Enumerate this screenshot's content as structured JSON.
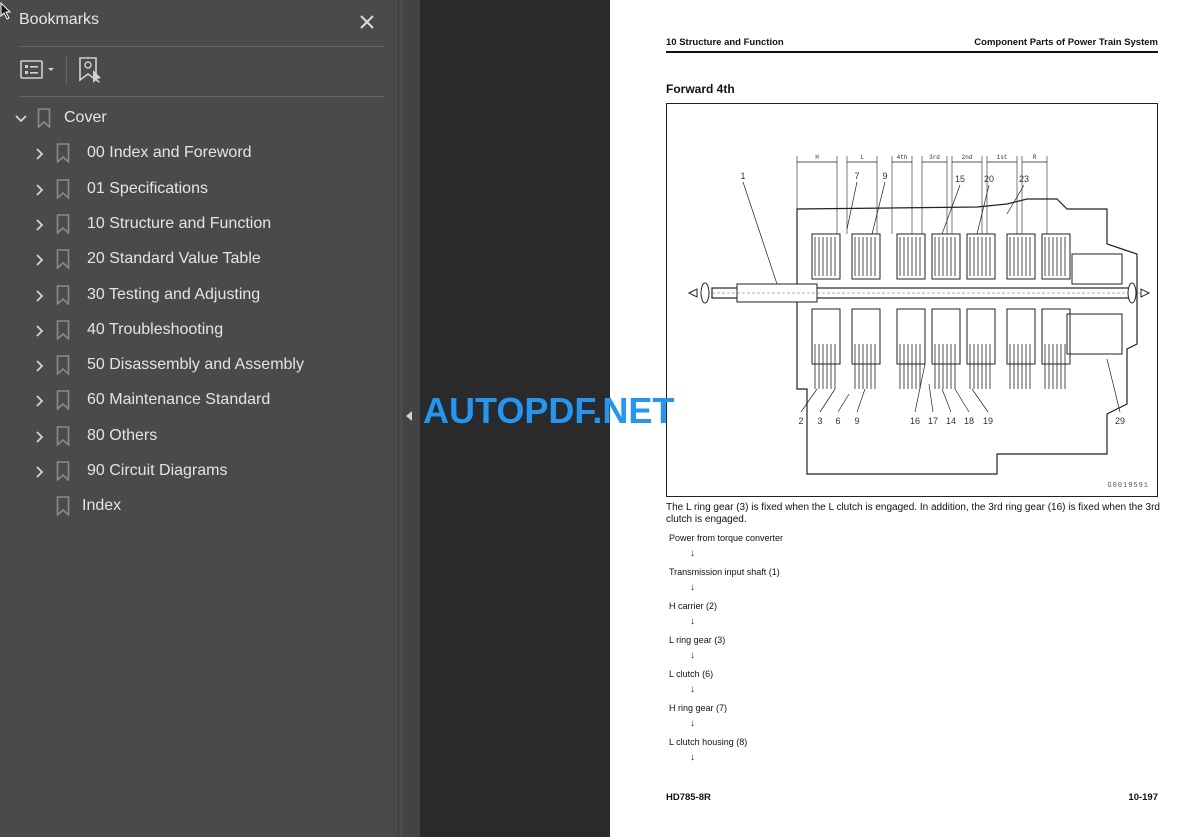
{
  "sidebar": {
    "title": "Bookmarks",
    "close_label": "✕",
    "toolbar": {
      "options_icon": "list-options-icon",
      "find_bookmark_icon": "find-current-bookmark-icon"
    },
    "items": [
      {
        "label": "Cover",
        "level": 0,
        "expanded": true,
        "has_children": true
      },
      {
        "label": "00 Index and Foreword",
        "level": 1,
        "expanded": false,
        "has_children": true
      },
      {
        "label": "01 Specifications",
        "level": 1,
        "expanded": false,
        "has_children": true
      },
      {
        "label": "10 Structure and Function",
        "level": 1,
        "expanded": false,
        "has_children": true
      },
      {
        "label": "20 Standard Value Table",
        "level": 1,
        "expanded": false,
        "has_children": true
      },
      {
        "label": "30 Testing and Adjusting",
        "level": 1,
        "expanded": false,
        "has_children": true
      },
      {
        "label": "40 Troubleshooting",
        "level": 1,
        "expanded": false,
        "has_children": true
      },
      {
        "label": "50 Disassembly and Assembly",
        "level": 1,
        "expanded": false,
        "has_children": true
      },
      {
        "label": "60 Maintenance Standard",
        "level": 1,
        "expanded": false,
        "has_children": true
      },
      {
        "label": "80 Others",
        "level": 1,
        "expanded": false,
        "has_children": true
      },
      {
        "label": "90 Circuit Diagrams",
        "level": 1,
        "expanded": false,
        "has_children": true
      },
      {
        "label": "Index",
        "level": 1,
        "expanded": false,
        "has_children": false
      }
    ]
  },
  "watermark": "AUTOPDF.NET",
  "page": {
    "header_left": "10 Structure and Function",
    "header_right": "Component Parts of Power Train System",
    "section_title": "Forward 4th",
    "figure": {
      "id": "G0019591",
      "range_labels": [
        "H",
        "L",
        "4th",
        "3rd",
        "2nd",
        "1st",
        "R"
      ],
      "top_callouts": [
        "1",
        "7",
        "9",
        "15",
        "20",
        "23"
      ],
      "bottom_callouts": [
        "2",
        "3",
        "6",
        "9",
        "16",
        "17",
        "14",
        "18",
        "19",
        "29"
      ]
    },
    "description": "The L ring gear (3) is fixed when the L clutch is engaged. In addition, the 3rd ring gear (16) is fixed when the 3rd clutch is engaged.",
    "flow": [
      "Power from torque converter",
      "Transmission input shaft (1)",
      "H carrier (2)",
      "L ring gear (3)",
      "L clutch (6)",
      "H ring gear (7)",
      "L clutch housing (8)"
    ],
    "flow_arrow": "↓",
    "footer_left": "HD785-8R",
    "footer_right": "10-197"
  }
}
